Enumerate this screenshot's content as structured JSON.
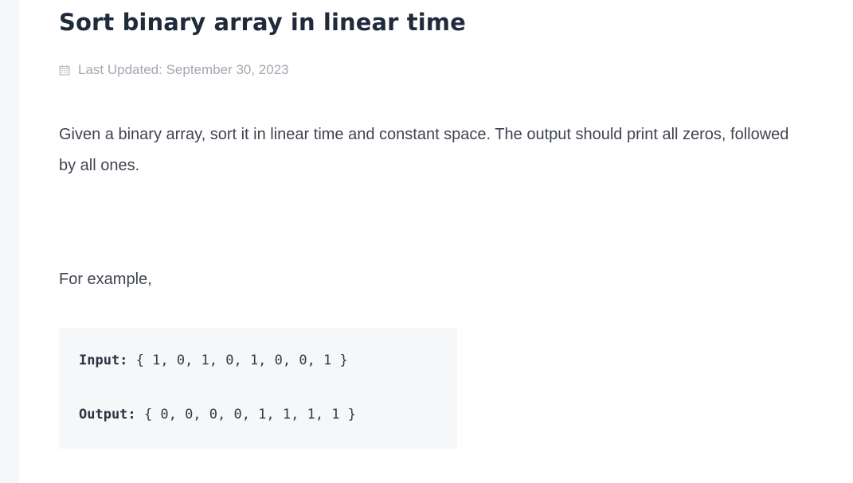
{
  "article": {
    "title": "Sort binary array in linear time",
    "last_updated": "Last Updated: September 30, 2023",
    "intro": "Given a binary array, sort it in linear time and constant space. The output should print all zeros, followed by all ones.",
    "example_label": "For example,"
  },
  "code_example": {
    "input_key": "Input:",
    "input_value": " { 1, 0, 1, 0, 1, 0, 0, 1 }",
    "output_key": "Output:",
    "output_value": " { 0, 0, 0, 0, 1, 1, 1, 1 }"
  },
  "icons": {
    "date": "calendar-icon"
  }
}
